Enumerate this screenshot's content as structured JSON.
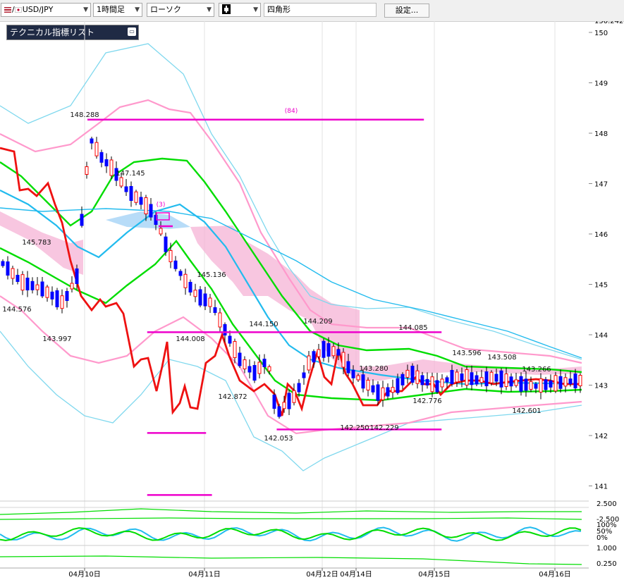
{
  "toolbar": {
    "symbol": "USD/JPY",
    "timeframe": "1時間足",
    "chart_style": "ローソク",
    "color_tool": "",
    "drawing_tool": "四角形",
    "settings_label": "設定..."
  },
  "indicator_panel": {
    "title": "テクニカル指標リスト"
  },
  "chart_data": [
    {
      "type": "candlestick",
      "pair": "USD/JPY",
      "interval": "1時間足",
      "ylim": [
        140.85,
        150.242
      ],
      "y_ticks": [
        "150.242",
        "150",
        "149",
        "148",
        "147",
        "146",
        "145",
        "144",
        "143",
        "142",
        "141"
      ],
      "x_ticks": [
        "04月10日",
        "04月11日",
        "04月12日",
        "04月14日",
        "04月15日",
        "04月16日"
      ],
      "price_labels": [
        {
          "label": "148.288",
          "value": 148.288
        },
        {
          "label": "147.145",
          "value": 147.145
        },
        {
          "label": "145.783",
          "value": 145.783
        },
        {
          "label": "144.576",
          "value": 144.576
        },
        {
          "label": "143.997",
          "value": 143.997
        },
        {
          "label": "145.136",
          "value": 145.136
        },
        {
          "label": "144.008",
          "value": 144.008
        },
        {
          "label": "144.150",
          "value": 144.15
        },
        {
          "label": "144.209",
          "value": 144.209
        },
        {
          "label": "142.872",
          "value": 142.872
        },
        {
          "label": "142.053",
          "value": 142.053
        },
        {
          "label": "142.250",
          "value": 142.25
        },
        {
          "label": "142.229",
          "value": 142.229
        },
        {
          "label": "143.280",
          "value": 143.28
        },
        {
          "label": "144.085",
          "value": 144.085
        },
        {
          "label": "142.776",
          "value": 142.776
        },
        {
          "label": "143.596",
          "value": 143.596
        },
        {
          "label": "143.508",
          "value": 143.508
        },
        {
          "label": "143.266",
          "value": 143.266
        },
        {
          "label": "142.601",
          "value": 142.601
        }
      ],
      "annotations": [
        "(84)",
        "(3)"
      ],
      "horizontal_lines": [
        {
          "from": 0.0,
          "to": 0.72,
          "y": 148.27
        },
        {
          "from": 0.25,
          "to": 0.75,
          "y": 144.05
        },
        {
          "from": 0.47,
          "to": 0.75,
          "y": 142.12
        },
        {
          "from": 0.25,
          "to": 0.35,
          "y": 142.05
        },
        {
          "from": 0.25,
          "to": 0.36,
          "y": 140.82
        }
      ],
      "colors": {
        "candle_up": "#ff0000",
        "candle_down": "#0000ff",
        "ma_green": "#00dd00",
        "ma_cyan": "#22bbee",
        "bollinger_outer": "#7fd8ee",
        "bollinger_inner": "#ff99cc",
        "ichimoku_cloud": "#f5b3d6",
        "red_line": "#ee1111",
        "horizontal_line": "#ee00cc"
      }
    },
    {
      "type": "line",
      "panel": "oscillator",
      "y_ticks": [
        "2.500",
        "-2.500",
        "100%",
        "50%",
        "0%",
        "1.000",
        "0.250"
      ],
      "series_colors": [
        "#22bbee",
        "#00dd00"
      ]
    }
  ]
}
